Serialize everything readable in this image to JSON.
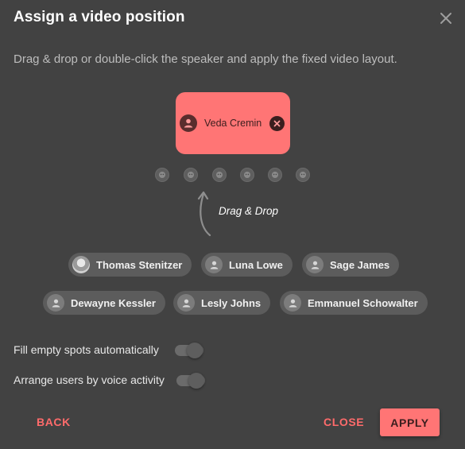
{
  "dialog": {
    "title": "Assign a video position",
    "description": "Drag & drop or double-click the speaker and apply the fixed video layout."
  },
  "active_speaker": {
    "name": "Veda Cremin"
  },
  "slot_count": 6,
  "drag_hint": "Drag & Drop",
  "participants": [
    {
      "name": "Thomas Stenitzer",
      "avatar": "photo"
    },
    {
      "name": "Luna Lowe",
      "avatar": "person-icon"
    },
    {
      "name": "Sage James",
      "avatar": "person-icon"
    },
    {
      "name": "Dewayne Kessler",
      "avatar": "person-icon"
    },
    {
      "name": "Lesly Johns",
      "avatar": "person-icon"
    },
    {
      "name": "Emmanuel Schowalter",
      "avatar": "person-icon"
    }
  ],
  "options": {
    "fill_empty": {
      "label": "Fill empty spots automatically",
      "enabled": false
    },
    "voice_activity": {
      "label": "Arrange users by voice activity",
      "enabled": false
    }
  },
  "actions": {
    "back": "BACK",
    "close": "CLOSE",
    "apply": "APPLY"
  },
  "colors": {
    "accent": "#ff7575",
    "background": "#424242",
    "chip": "#5c5c5c"
  }
}
